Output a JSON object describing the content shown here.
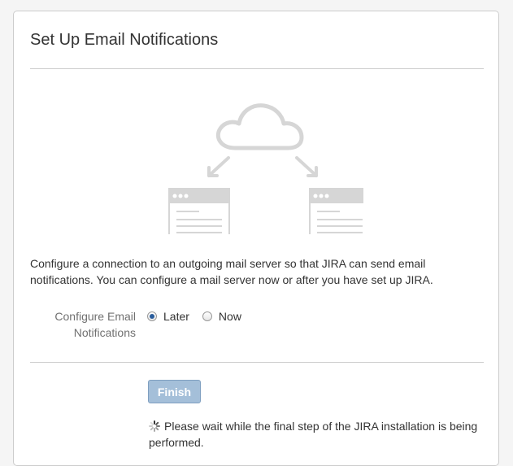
{
  "dialog": {
    "title": "Set Up Email Notifications",
    "description": "Configure a connection to an outgoing mail server so that JIRA can send email notifications. You can configure a mail server now or after you have set up JIRA.",
    "illustration_icons": [
      "cloud-icon",
      "arrow-down-left-icon",
      "arrow-down-right-icon",
      "browser-window-icon",
      "browser-window-icon"
    ]
  },
  "form": {
    "field_label": "Configure Email Notifications",
    "options": [
      {
        "label": "Later",
        "checked": true
      },
      {
        "label": "Now",
        "checked": false
      }
    ]
  },
  "actions": {
    "finish_label": "Finish",
    "finish_state": "disabled",
    "progress_text": "Please wait while the final step of the JIRA installation is being performed."
  },
  "colors": {
    "button_disabled": "#a4bfd9",
    "illustration": "#d6d6d6",
    "radio_checked": "#2a5d9c"
  }
}
